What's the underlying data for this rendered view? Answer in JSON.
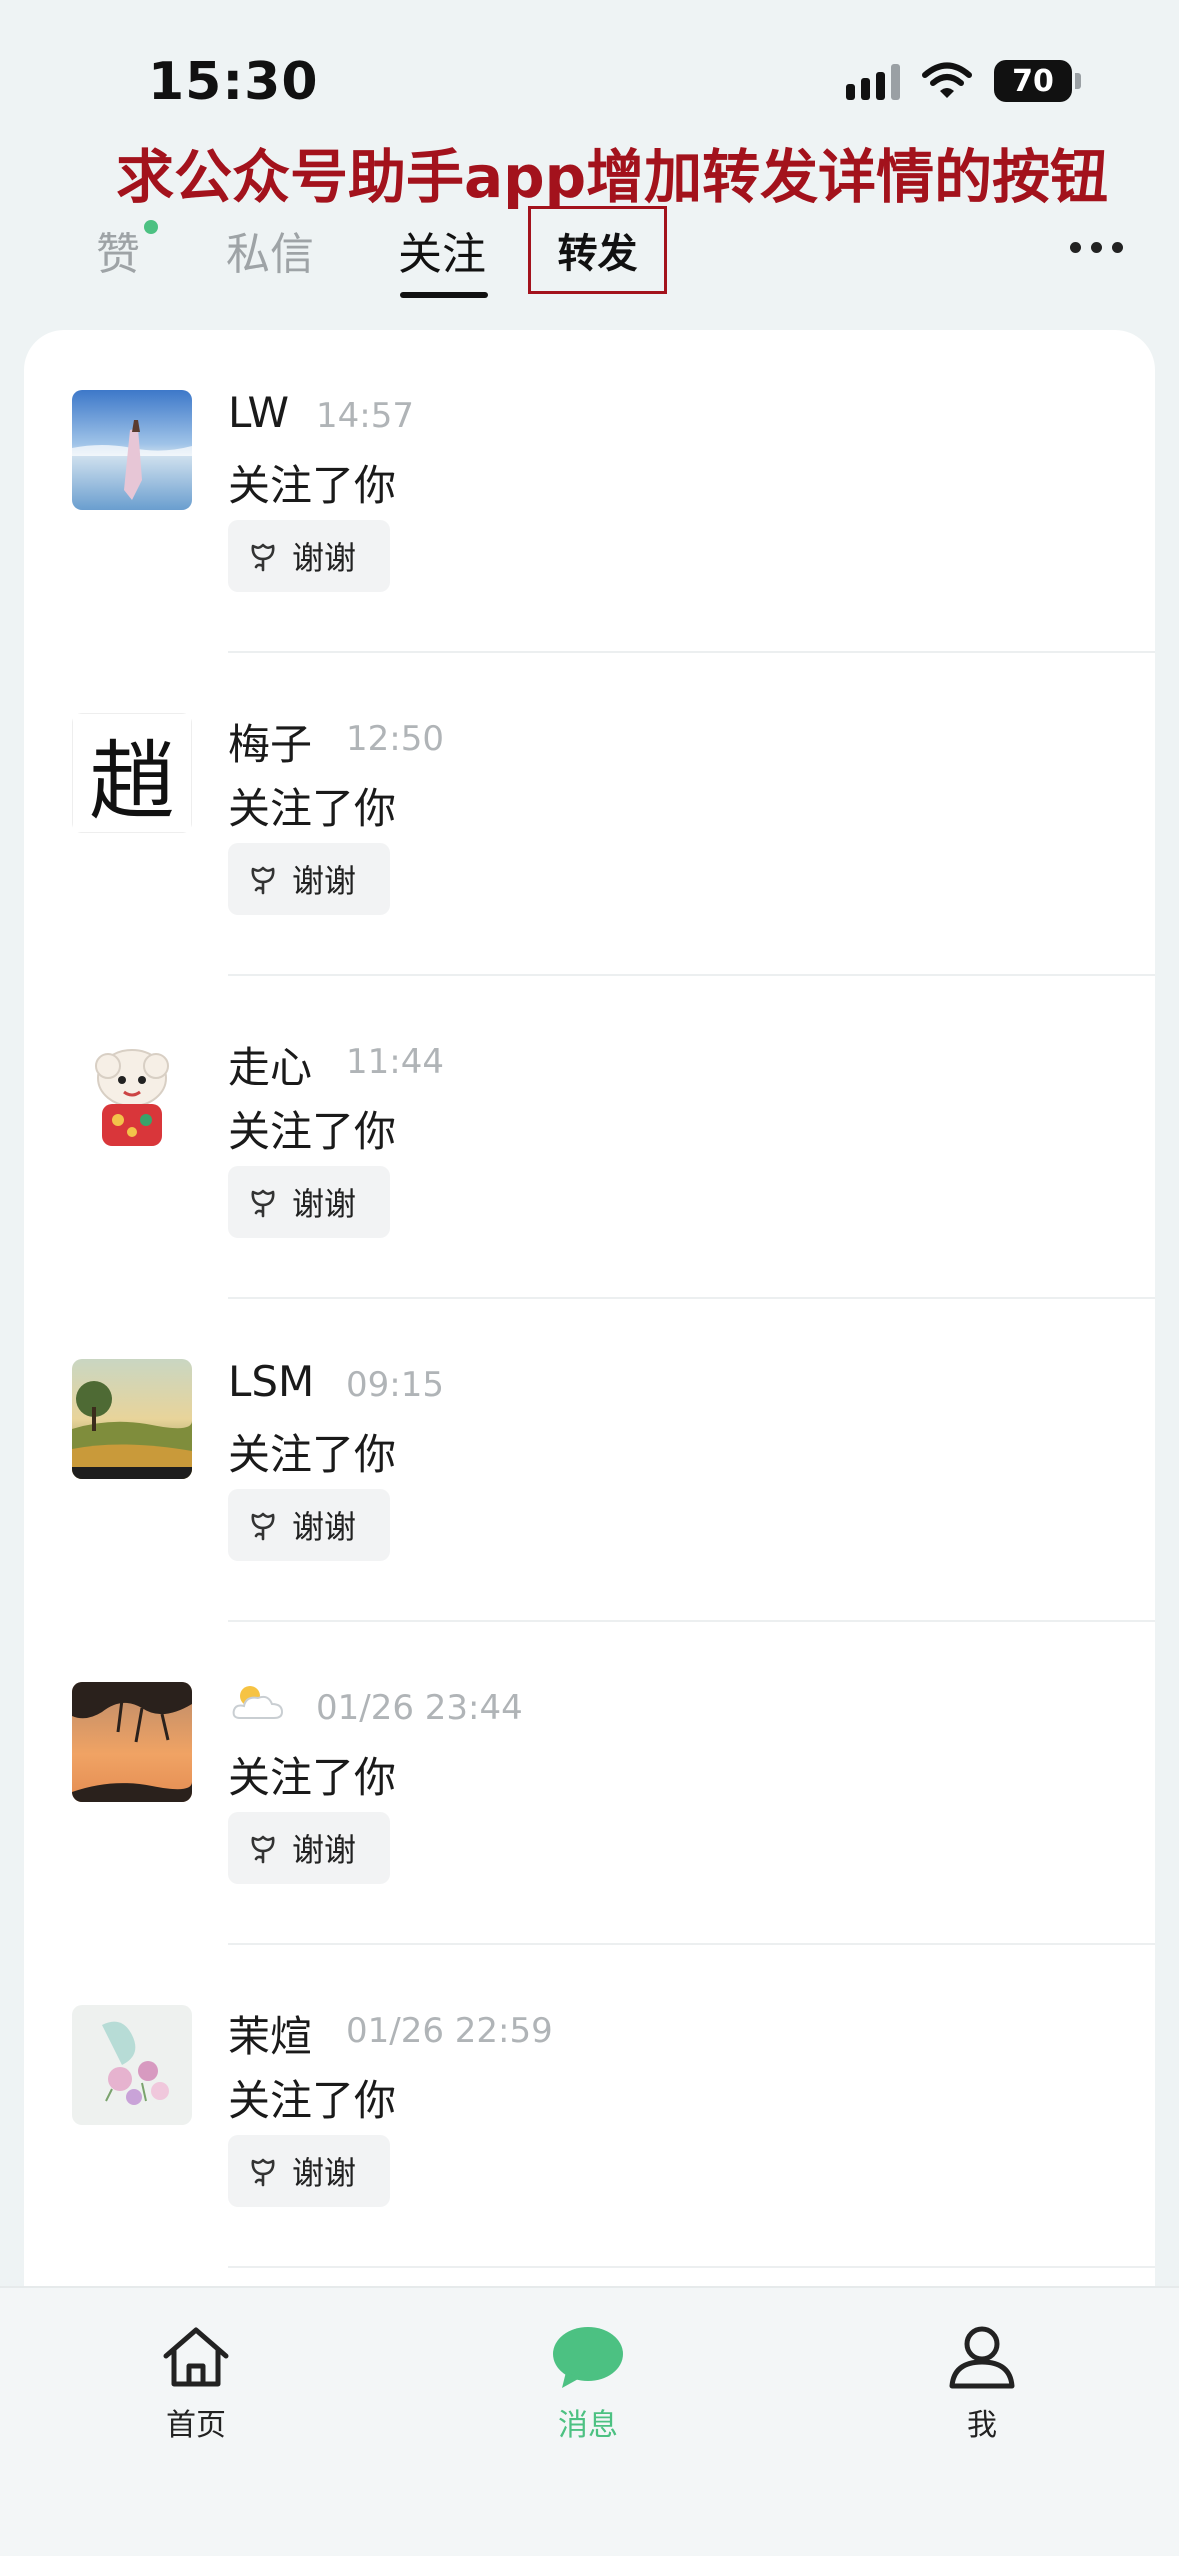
{
  "status_bar": {
    "time": "15:30",
    "battery": "70"
  },
  "annotation": "求公众号助手app增加转发详情的按钮",
  "tabs": {
    "like": "赞",
    "dm": "私信",
    "follow": "关注",
    "forward": "转发"
  },
  "list": {
    "items": [
      {
        "name": "LW",
        "time": "14:57",
        "text": "关注了你",
        "button": "谢谢"
      },
      {
        "name": "梅子",
        "time": "12:50",
        "text": "关注了你",
        "button": "谢谢",
        "avatar_glyph": "趙"
      },
      {
        "name": "走心",
        "time": "11:44",
        "text": "关注了你",
        "button": "谢谢"
      },
      {
        "name": "LSM",
        "time": "09:15",
        "text": "关注了你",
        "button": "谢谢"
      },
      {
        "name": "",
        "time": "01/26 23:44",
        "text": "关注了你",
        "button": "谢谢"
      },
      {
        "name": "茉煊",
        "time": "01/26 22:59",
        "text": "关注了你",
        "button": "谢谢"
      }
    ]
  },
  "bottom_nav": {
    "home": "首页",
    "messages": "消息",
    "me": "我"
  },
  "colors": {
    "accent": "#4cc182",
    "annotation": "#a3121c",
    "background": "#eef3f4"
  },
  "icons": {
    "thanks": "flower-icon",
    "home": "house-icon",
    "messages": "chat-bubble-icon",
    "me": "person-icon"
  }
}
